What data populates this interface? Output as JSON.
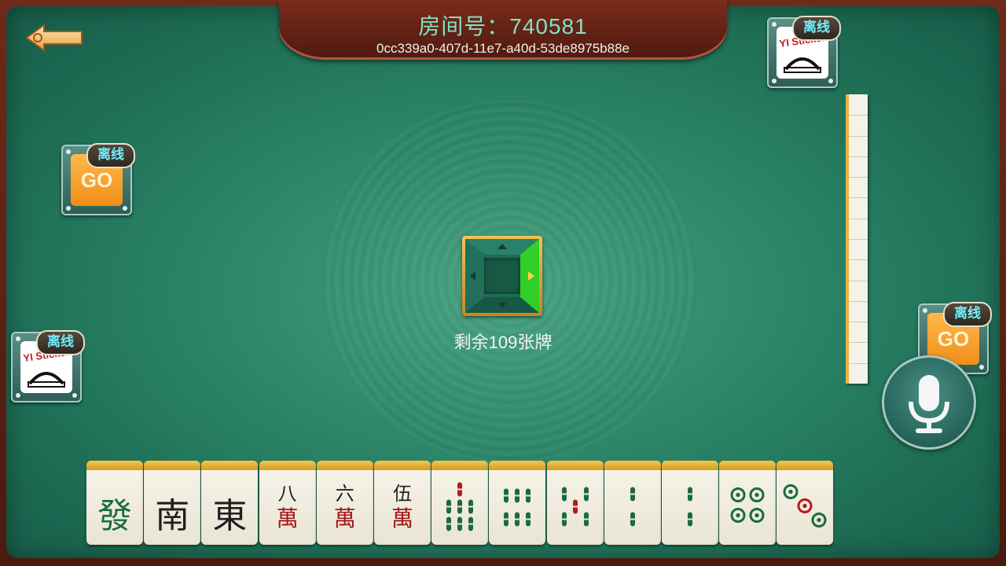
{
  "header": {
    "room_label": "房间号：740581",
    "room_uuid": "0cc339a0-407d-11e7-a40d-53de8975b88e"
  },
  "status": {
    "remaining_text": "剩余109张牌"
  },
  "players": [
    {
      "position": "top-right",
      "badge": "离线",
      "avatar_text": "YI Sticker"
    },
    {
      "position": "left-upper",
      "badge": "离线",
      "avatar_text": "GO"
    },
    {
      "position": "left-lower",
      "badge": "离线",
      "avatar_text": "YI Sticker"
    },
    {
      "position": "right",
      "badge": "离线",
      "avatar_text": "GO"
    }
  ],
  "hand": [
    {
      "kind": "honor",
      "label": "發",
      "color": "#1a6b3a"
    },
    {
      "kind": "honor",
      "label": "南",
      "color": "#1e1e1e"
    },
    {
      "kind": "honor",
      "label": "東",
      "color": "#1e1e1e"
    },
    {
      "kind": "character",
      "number": "八",
      "suit": "萬"
    },
    {
      "kind": "character",
      "number": "六",
      "suit": "萬"
    },
    {
      "kind": "character",
      "number": "伍",
      "suit": "萬"
    },
    {
      "kind": "bamboo",
      "count": 7
    },
    {
      "kind": "bamboo",
      "count": 6
    },
    {
      "kind": "bamboo",
      "count": 5
    },
    {
      "kind": "bamboo",
      "count": 2
    },
    {
      "kind": "bamboo",
      "count": 2
    },
    {
      "kind": "dots",
      "count": 4
    },
    {
      "kind": "dots",
      "count": 3
    }
  ],
  "icons": {
    "back": "back-arrow-icon",
    "mic": "microphone-icon",
    "turn": "turn-indicator-icon"
  },
  "colors": {
    "felt": "#2f8a6c",
    "frame": "#5a2418",
    "room_text": "#7fe3c4",
    "badge_text": "#72f0ff",
    "tile_top": "#e6b63a",
    "active_turn": "#36e021"
  }
}
